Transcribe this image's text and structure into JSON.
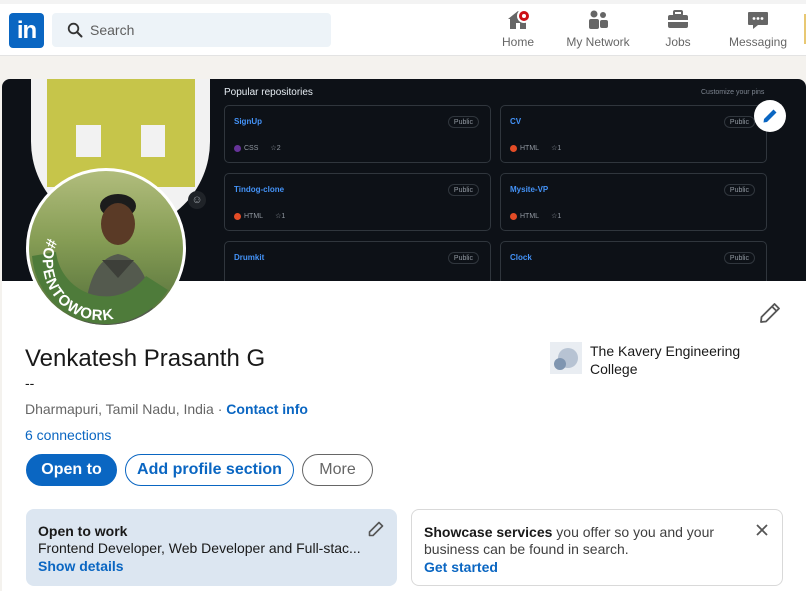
{
  "nav": {
    "logo": "in",
    "search_placeholder": "Search",
    "items": [
      {
        "label": "Home",
        "icon": "home-icon"
      },
      {
        "label": "My Network",
        "icon": "people-icon"
      },
      {
        "label": "Jobs",
        "icon": "briefcase-icon"
      },
      {
        "label": "Messaging",
        "icon": "chat-icon"
      }
    ]
  },
  "banner": {
    "title": "Popular repositories",
    "customize": "Customize your pins",
    "repos": [
      {
        "name": "SignUp",
        "visibility": "Public",
        "lang": "CSS",
        "lang_color": "#663399",
        "stars": "2"
      },
      {
        "name": "CV",
        "visibility": "Public",
        "lang": "HTML",
        "lang_color": "#e34c26",
        "stars": "1"
      },
      {
        "name": "Tindog-clone",
        "visibility": "Public",
        "lang": "HTML",
        "lang_color": "#e34c26",
        "stars": "1"
      },
      {
        "name": "Mysite-VP",
        "visibility": "Public",
        "lang": "HTML",
        "lang_color": "#e34c26",
        "stars": "1"
      },
      {
        "name": "Drumkit",
        "visibility": "Public"
      },
      {
        "name": "Clock",
        "visibility": "Public"
      }
    ]
  },
  "profile": {
    "frame_text": "#OPENTOWORK",
    "name": "Venkatesh Prasanth G",
    "headline": "--",
    "location": "Dharmapuri, Tamil Nadu, India · ",
    "contact": "Contact info",
    "connections": "6 connections",
    "college": "The Kavery Engineering College"
  },
  "actions": {
    "open_to": "Open to",
    "add_section": "Add profile section",
    "more": "More"
  },
  "open_to_work": {
    "title": "Open to work",
    "roles": "Frontend Developer, Web Developer and Full-stac...",
    "link": "Show details"
  },
  "showcase": {
    "bold": "Showcase services",
    "text": " you offer so you and your business can be found in search.",
    "link": "Get started"
  },
  "colors": {
    "brand": "#0a66c2",
    "open_to_work_green": "#4e7b3a",
    "banner_bg": "#0d1117"
  }
}
